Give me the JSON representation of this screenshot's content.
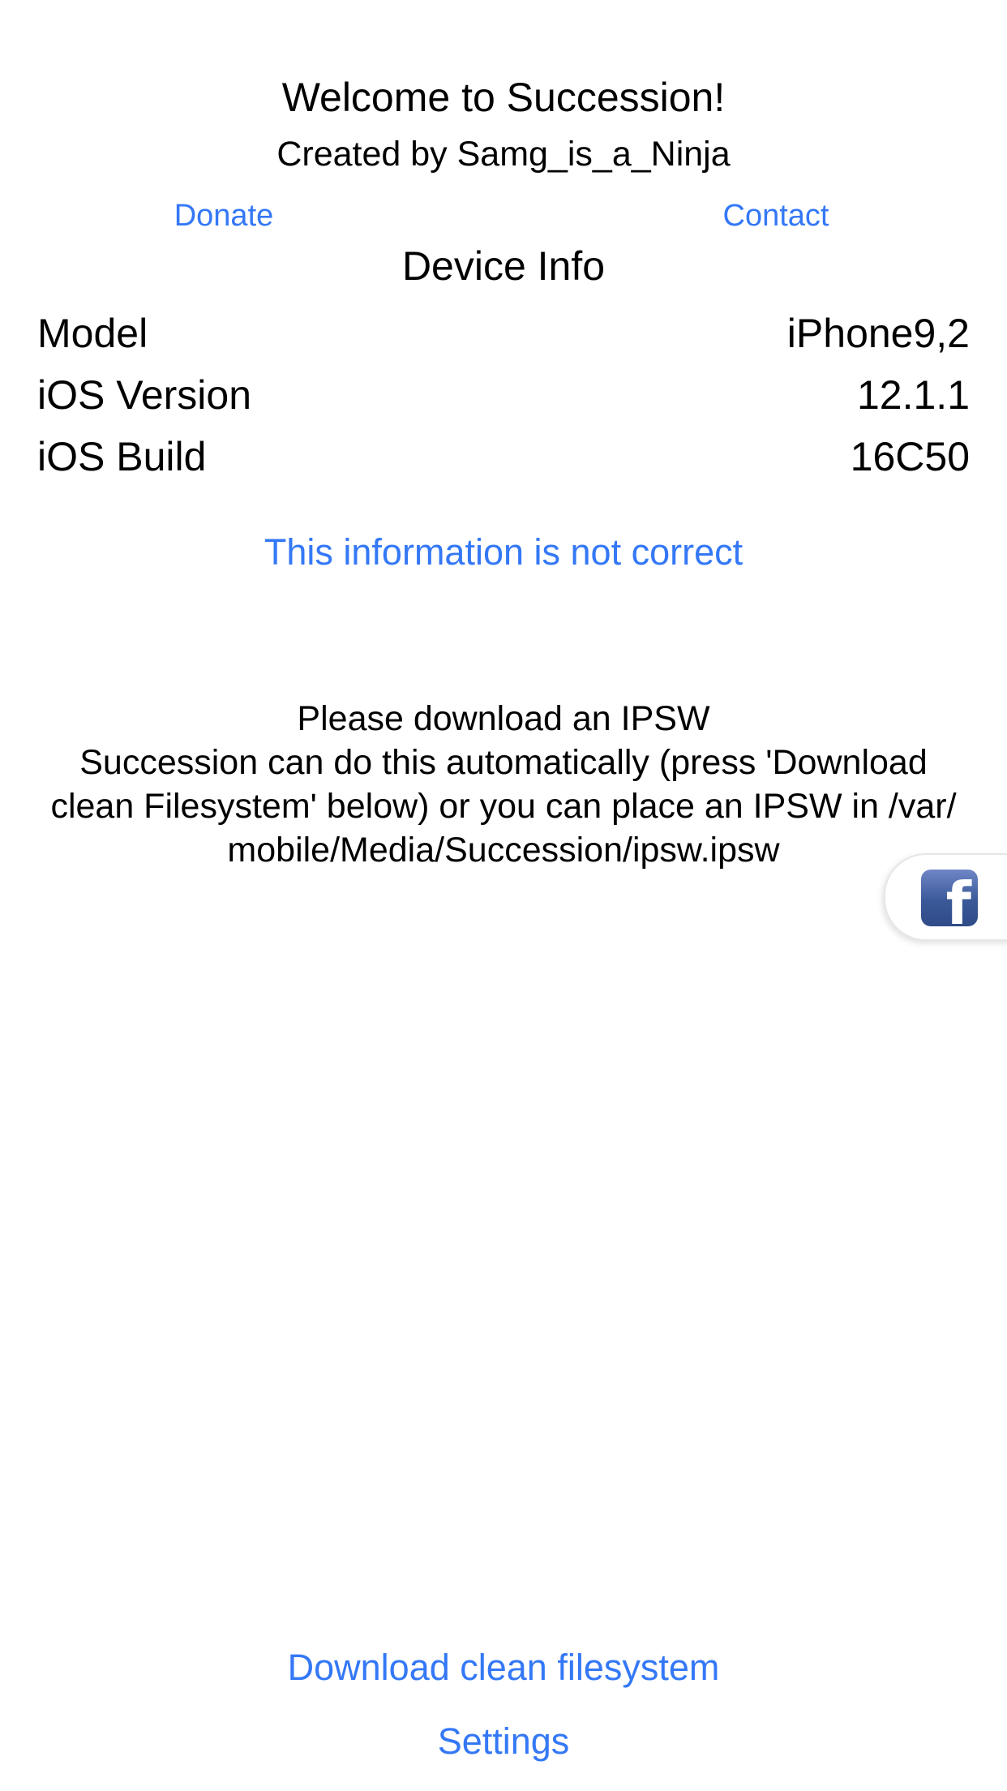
{
  "header": {
    "title": "Welcome to Succession!",
    "subtitle": "Created by Samg_is_a_Ninja",
    "donate_label": "Donate",
    "contact_label": "Contact"
  },
  "device_info": {
    "section_title": "Device Info",
    "rows": [
      {
        "label": "Model",
        "value": "iPhone9,2"
      },
      {
        "label": "iOS Version",
        "value": "12.1.1"
      },
      {
        "label": "iOS Build",
        "value": "16C50"
      }
    ],
    "not_correct_label": "This information is not correct"
  },
  "notice": {
    "lines": [
      "Please download an IPSW",
      "Succession can do this automatically (press 'Download",
      "clean Filesystem' below) or you can place an IPSW in /var/",
      "mobile/Media/Succession/ipsw.ipsw"
    ]
  },
  "floating": {
    "icon": "facebook-icon",
    "glyph": "f"
  },
  "footer": {
    "download_label": "Download clean filesystem",
    "settings_label": "Settings"
  },
  "colors": {
    "link": "#3478f6",
    "text": "#000000",
    "background": "#ffffff",
    "facebook": "#3b5998"
  }
}
